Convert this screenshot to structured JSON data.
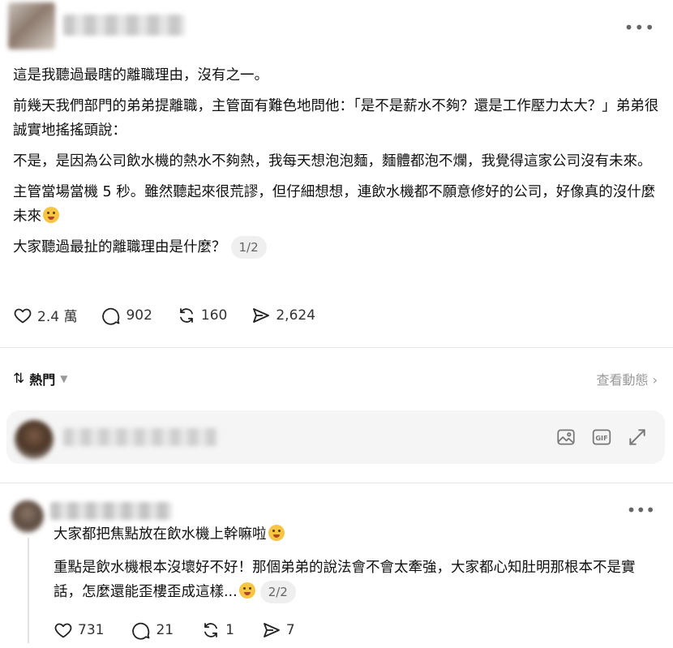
{
  "post": {
    "paragraphs": [
      "這是我聽過最瞎的離職理由，沒有之一。",
      "前幾天我們部門的弟弟提離職，主管面有難色地問他：「是不是薪水不夠？還是工作壓力太大？」弟弟很誠實地搖搖頭說：",
      "不是，是因為公司飲水機的熱水不夠熱，我每天想泡泡麵，麵體都泡不爛，我覺得這家公司沒有未來。",
      "主管當場當機 5 秒。雖然聽起來很荒謬，但仔細想想，連飲水機都不願意修好的公司，好像真的沒什麼未來"
    ],
    "question": "大家聽過最扯的離職理由是什麼？",
    "page_indicator": "1/2",
    "likes": "2.4 萬",
    "comments": "902",
    "reposts": "160",
    "shares": "2,624"
  },
  "sort": {
    "label": "熱門",
    "activity_link": "查看動態 ›"
  },
  "comment": {
    "text": "大家都把焦點放在飲水機上幹嘛啦",
    "reply_text": "重點是飲水機根本沒壞好不好！那個弟弟的說法會不會太牽強，大家都心知肚明那根本不是實話，怎麼還能歪樓歪成這樣...",
    "page_indicator": "2/2",
    "likes": "731",
    "comments": "21",
    "reposts": "1",
    "shares": "7"
  },
  "icons": {
    "more": "more-horizontal-icon",
    "like": "heart-icon",
    "comment": "comment-bubble-icon",
    "repost": "repost-icon",
    "share": "share-icon",
    "image": "image-icon",
    "gif": "gif-icon",
    "expand": "expand-icon"
  }
}
